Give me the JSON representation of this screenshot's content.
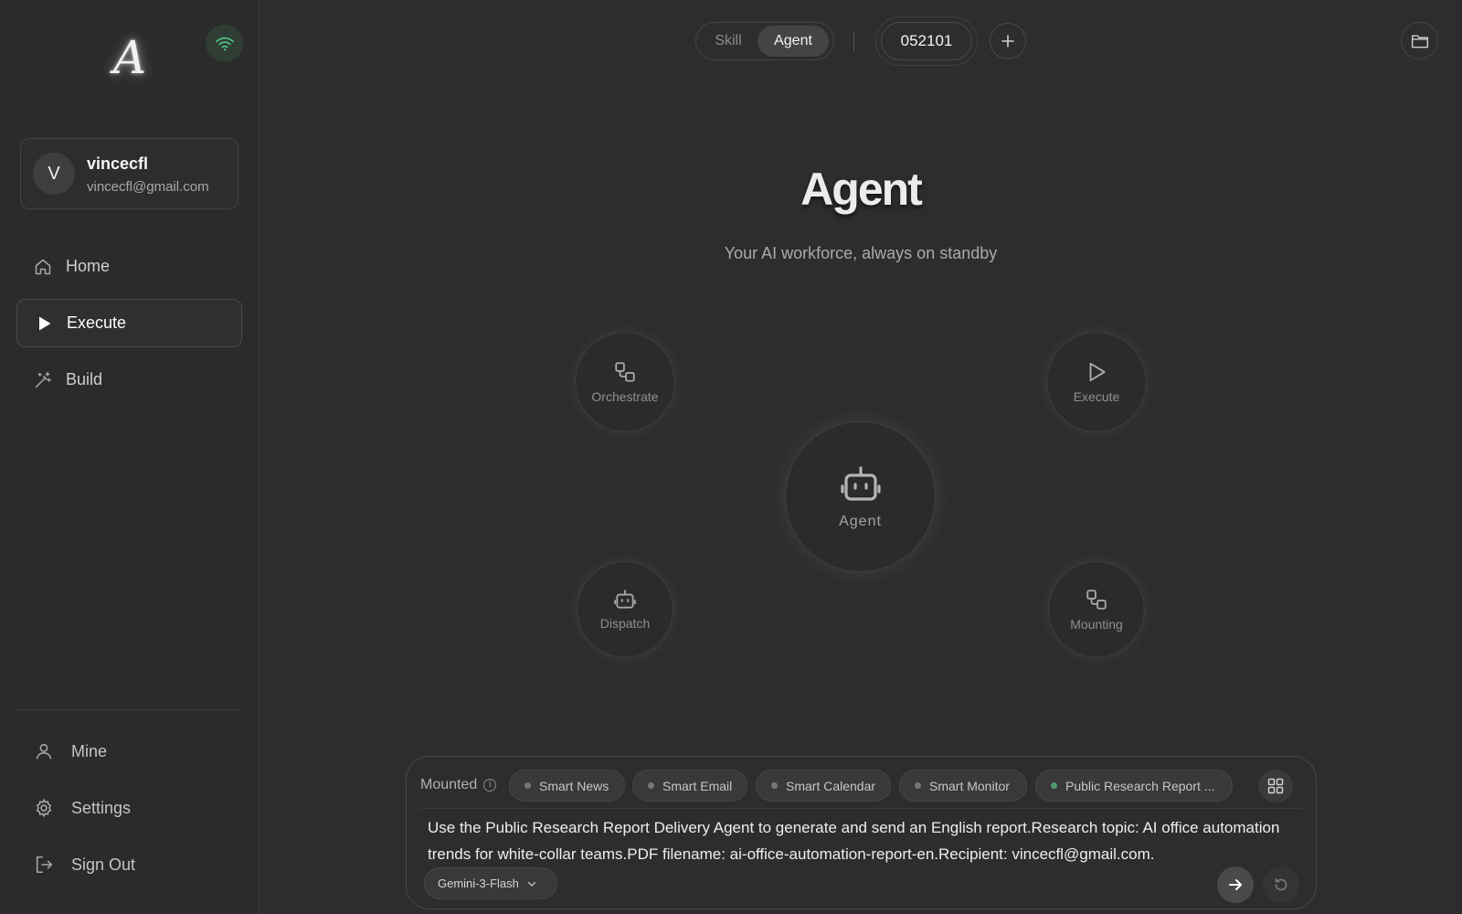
{
  "sidebar": {
    "logo_letter": "A",
    "user": {
      "initial": "V",
      "name": "vincecfl",
      "email": "vincecfl@gmail.com"
    },
    "nav": [
      {
        "label": "Home",
        "icon": "home-icon"
      },
      {
        "label": "Execute",
        "icon": "play-icon",
        "active": true
      },
      {
        "label": "Build",
        "icon": "magic-wand-icon"
      }
    ],
    "bottom": [
      {
        "label": "Mine",
        "icon": "user-icon"
      },
      {
        "label": "Settings",
        "icon": "gear-icon"
      },
      {
        "label": "Sign Out",
        "icon": "sign-out-icon"
      }
    ]
  },
  "topbar": {
    "toggle": {
      "skill": "Skill",
      "agent": "Agent",
      "selected": "Agent"
    },
    "code": "052101"
  },
  "hero": {
    "title": "Agent",
    "subtitle": "Your AI workforce, always on standby",
    "center_label": "Agent",
    "orbits": {
      "orchestrate": "Orchestrate",
      "execute": "Execute",
      "dispatch": "Dispatch",
      "mounting": "Mounting"
    }
  },
  "composer": {
    "mounted_label": "Mounted",
    "chips": [
      {
        "label": "Smart News",
        "status": "inactive"
      },
      {
        "label": "Smart Email",
        "status": "inactive"
      },
      {
        "label": "Smart Calendar",
        "status": "inactive"
      },
      {
        "label": "Smart Monitor",
        "status": "inactive"
      },
      {
        "label": "Public Research Report ...",
        "status": "active"
      }
    ],
    "prompt": "Use the Public Research Report Delivery Agent to generate and send an English report.Research topic: AI office automation trends for white-collar teams.PDF filename: ai-office-automation-report-en.Recipient: vincecfl@gmail.com.",
    "model": "Gemini-3-Flash"
  },
  "colors": {
    "background": "#2d2d2d",
    "wifi_accent": "#4fbf7f",
    "active_dot": "#4f9a6d"
  }
}
